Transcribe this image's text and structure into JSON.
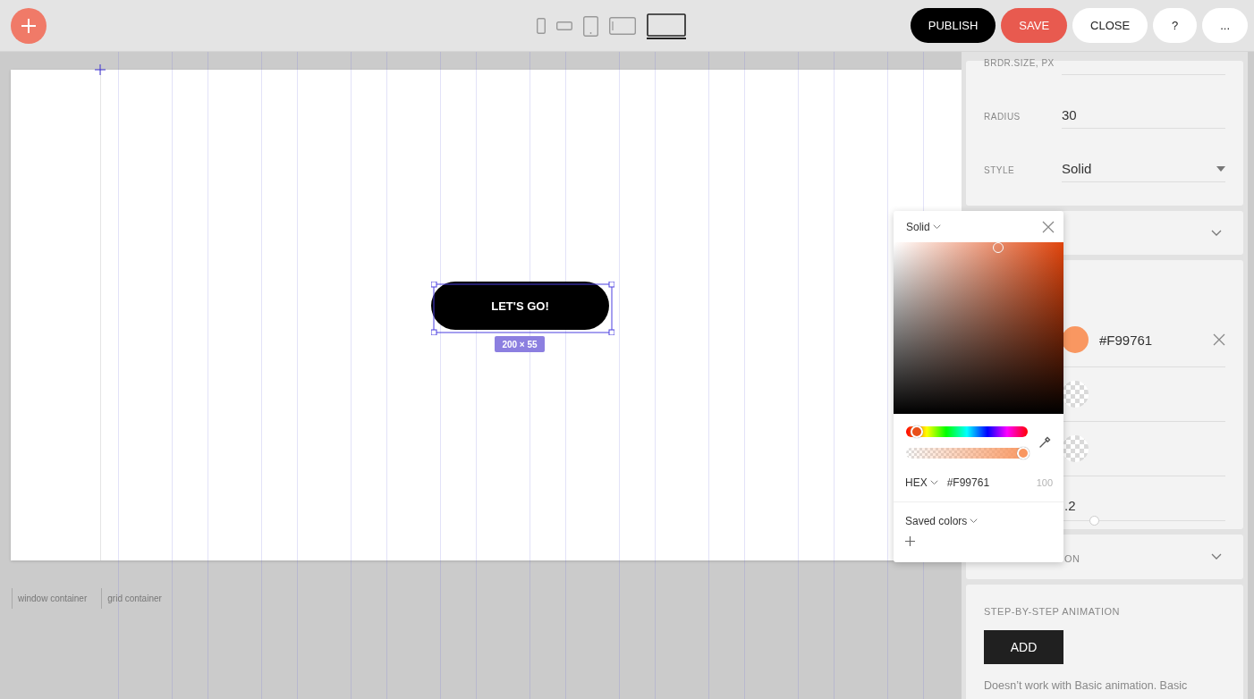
{
  "toolbar": {
    "devices": [
      {
        "kind": "phone",
        "selected": false
      },
      {
        "kind": "phone-landscape",
        "selected": false
      },
      {
        "kind": "tablet",
        "selected": false
      },
      {
        "kind": "tablet-landscape",
        "selected": false
      },
      {
        "kind": "desktop",
        "selected": true
      }
    ],
    "actions": [
      {
        "label": "PUBLISH",
        "kind": "primary"
      },
      {
        "label": "SAVE",
        "kind": "accent"
      },
      {
        "label": "CLOSE",
        "kind": "plain"
      },
      {
        "label": "?",
        "kind": "plain"
      },
      {
        "label": "...",
        "kind": "plain"
      }
    ]
  },
  "canvas": {
    "element": {
      "label": "LET'S GO!",
      "size": "200 × 55",
      "selected": true
    },
    "breadcrumbs": [
      "window container",
      "grid container"
    ]
  },
  "panel": {
    "fields": [
      {
        "label": "BRDR.SIZE, PX",
        "kind": "text"
      },
      {
        "label": "RADIUS",
        "value": "30",
        "kind": "text"
      },
      {
        "label": "STYLE",
        "value": "Solid",
        "kind": "select"
      }
    ],
    "collapsed_section": {
      "expanded": false
    },
    "color_rows": [
      {
        "kind": "color",
        "color": "#f99761",
        "value": "#F99761"
      },
      {
        "kind": "empty"
      },
      {
        "kind": "empty"
      }
    ],
    "opacity": {
      "reading": ".2",
      "level": 0.2
    },
    "second_section": {
      "title": "ON",
      "expanded": false
    },
    "animation": {
      "title": "STEP-BY-STEP ANIMATION",
      "button": "ADD",
      "note": "Doesn’t work with Basic animation. Basic"
    }
  },
  "color_picker": {
    "mode": "Solid",
    "hue": {
      "level": 0.09
    },
    "alpha": {
      "level": 0.96
    },
    "format": "HEX",
    "hex": "#F99761",
    "opacity": "100",
    "saved_colors": "Saved colors"
  }
}
